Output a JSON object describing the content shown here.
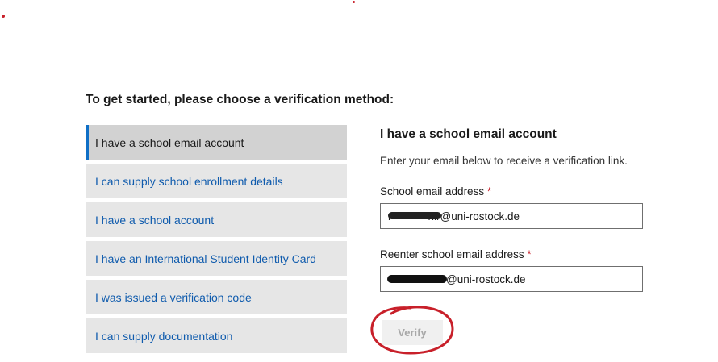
{
  "colors": {
    "accent": "#0f6fc6",
    "link": "#0f5bad",
    "required": "#c8202a",
    "annotation": "#c8202a",
    "tab_bg": "#e6e6e6",
    "tab_selected_bg": "#d2d2d2"
  },
  "heading": "To get started, please choose a verification method:",
  "methods": [
    {
      "label": "I have a school email account",
      "selected": true
    },
    {
      "label": "I can supply school enrollment details",
      "selected": false
    },
    {
      "label": "I have a school account",
      "selected": false
    },
    {
      "label": "I have an International Student Identity Card",
      "selected": false
    },
    {
      "label": "I was issued a verification code",
      "selected": false
    },
    {
      "label": "I can supply documentation",
      "selected": false
    }
  ],
  "panel": {
    "title": "I have a school email account",
    "description": "Enter your email below to receive a verification link.",
    "email_label": "School email address",
    "reenter_label": "Reenter school email address",
    "required_marker": "*",
    "email_value": "r            hir@uni-rostock.de",
    "reenter_value": "                  r@uni-rostock.de",
    "verify_label": "Verify"
  }
}
